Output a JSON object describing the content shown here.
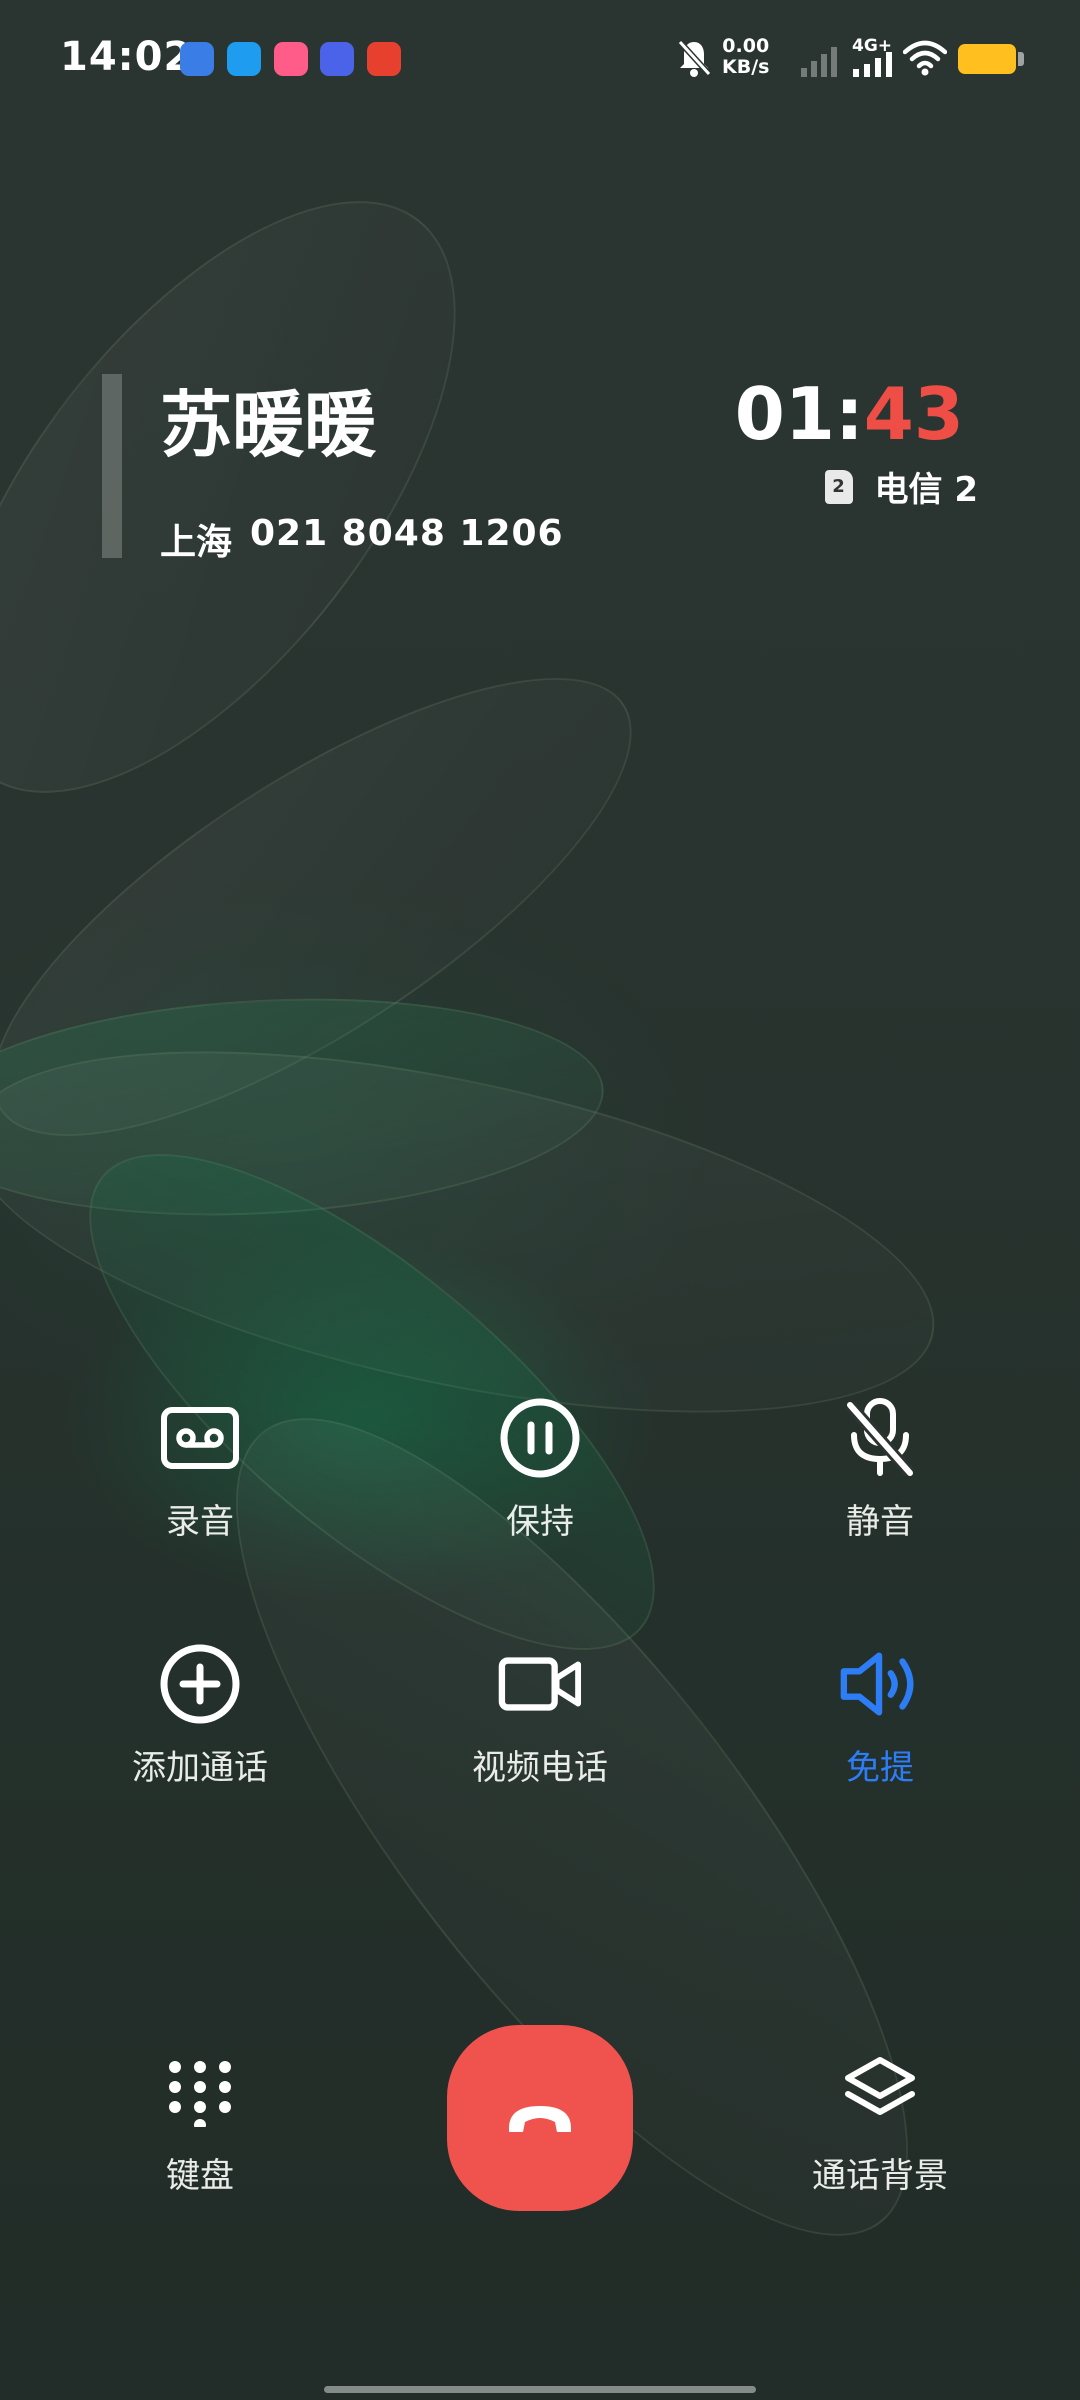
{
  "status_bar": {
    "time": "14:02",
    "app_icons": [
      "app-blue-icon",
      "app-cloud-icon",
      "app-bili-icon",
      "app-vivo-icon",
      "app-taobao-icon"
    ],
    "app_colors": [
      "#3a7de6",
      "#1e9cf0",
      "#ff5c8a",
      "#4a63e8",
      "#e8402f"
    ],
    "speed_value": "0.00",
    "speed_unit": "KB/s",
    "network": "4G+",
    "battery_color": "#ffbf1f"
  },
  "call": {
    "name": "苏暖暖",
    "location": "上海",
    "number": "021 8048 1206",
    "timer_min": "01:",
    "timer_sec": "43",
    "sim_slot": "2",
    "carrier": "电信 2"
  },
  "controls": {
    "record": "录音",
    "hold": "保持",
    "mute": "静音",
    "add_call": "添加通话",
    "video_call": "视频电话",
    "speaker": "免提",
    "keypad": "键盘",
    "background": "通话背景"
  },
  "colors": {
    "accent": "#2d7df6",
    "hangup": "#f0534d",
    "timer_seconds": "#ee4e45"
  }
}
